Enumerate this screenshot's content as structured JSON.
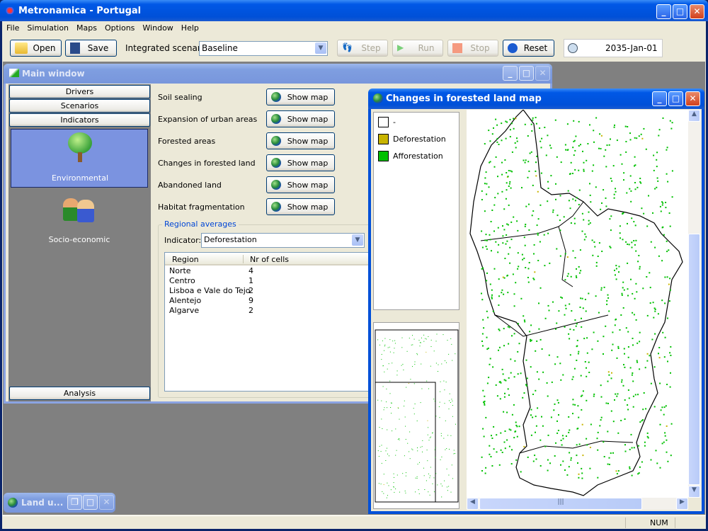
{
  "app": {
    "title": "Metronamica - Portugal"
  },
  "menu": [
    "File",
    "Simulation",
    "Maps",
    "Options",
    "Window",
    "Help"
  ],
  "toolbar": {
    "open": "Open",
    "save": "Save",
    "scenario_label": "Integrated scenario:",
    "scenario_value": "Baseline",
    "step": "Step",
    "run": "Run",
    "stop": "Stop",
    "reset": "Reset",
    "date": "2035-Jan-01"
  },
  "main_window": {
    "title": "Main window",
    "nav": {
      "drivers": "Drivers",
      "scenarios": "Scenarios",
      "indicators": "Indicators",
      "analysis": "Analysis"
    },
    "categories": [
      {
        "label": "Environmental",
        "selected": true
      },
      {
        "label": "Socio-economic",
        "selected": false
      }
    ],
    "indicators": [
      {
        "label": "Soil sealing",
        "button": "Show map"
      },
      {
        "label": "Expansion of urban areas",
        "button": "Show map"
      },
      {
        "label": "Forested areas",
        "button": "Show map"
      },
      {
        "label": "Changes in forested land",
        "button": "Show map"
      },
      {
        "label": "Abandoned land",
        "button": "Show map"
      },
      {
        "label": "Habitat fragmentation",
        "button": "Show map"
      }
    ],
    "regional": {
      "group_title": "Regional averages",
      "indicator_label": "Indicator:",
      "indicator_value": "Deforestation",
      "columns": [
        "Region",
        "Nr of cells"
      ],
      "rows": [
        [
          "Norte",
          "4"
        ],
        [
          "Centro",
          "1"
        ],
        [
          "Lisboa e Vale do Tejo",
          "2"
        ],
        [
          "Alentejo",
          "9"
        ],
        [
          "Algarve",
          "2"
        ]
      ]
    }
  },
  "map_window": {
    "title": "Changes in forested land map",
    "legend": [
      {
        "label": "-",
        "color": "#ffffff"
      },
      {
        "label": "Deforestation",
        "color": "#c8b400"
      },
      {
        "label": "Afforestation",
        "color": "#00c000"
      }
    ]
  },
  "minimized_window": {
    "title": "Land u..."
  },
  "status": {
    "num": "NUM"
  },
  "colors": {
    "title_blue": "#0058e6",
    "mdi_gray": "#808080",
    "selected_panel": "#7b93e0",
    "afforestation": "#00c000"
  }
}
